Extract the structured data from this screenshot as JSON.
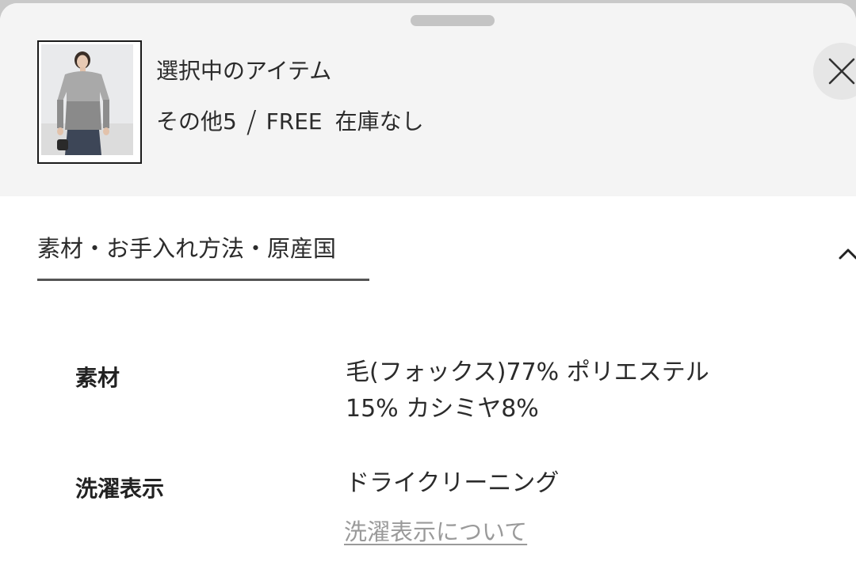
{
  "selected_item": {
    "title": "選択中のアイテム",
    "color": "その他5",
    "separator": "/",
    "size": "FREE",
    "stock_status": "在庫なし"
  },
  "section": {
    "title": "素材・お手入れ方法・原産国"
  },
  "specs": {
    "material": {
      "label": "素材",
      "value_line1": "毛(フォックス)77% ポリエステル",
      "value_line2": "15% カシミヤ8%"
    },
    "care": {
      "label": "洗濯表示",
      "value": "ドライクリーニング",
      "link": "洗濯表示について"
    }
  },
  "icons": {
    "close": "close-icon",
    "collapse": "chevron-up-icon"
  },
  "colors": {
    "panel_bg": "#f4f4f4",
    "link": "#9a9a9a",
    "underline": "#555555"
  }
}
